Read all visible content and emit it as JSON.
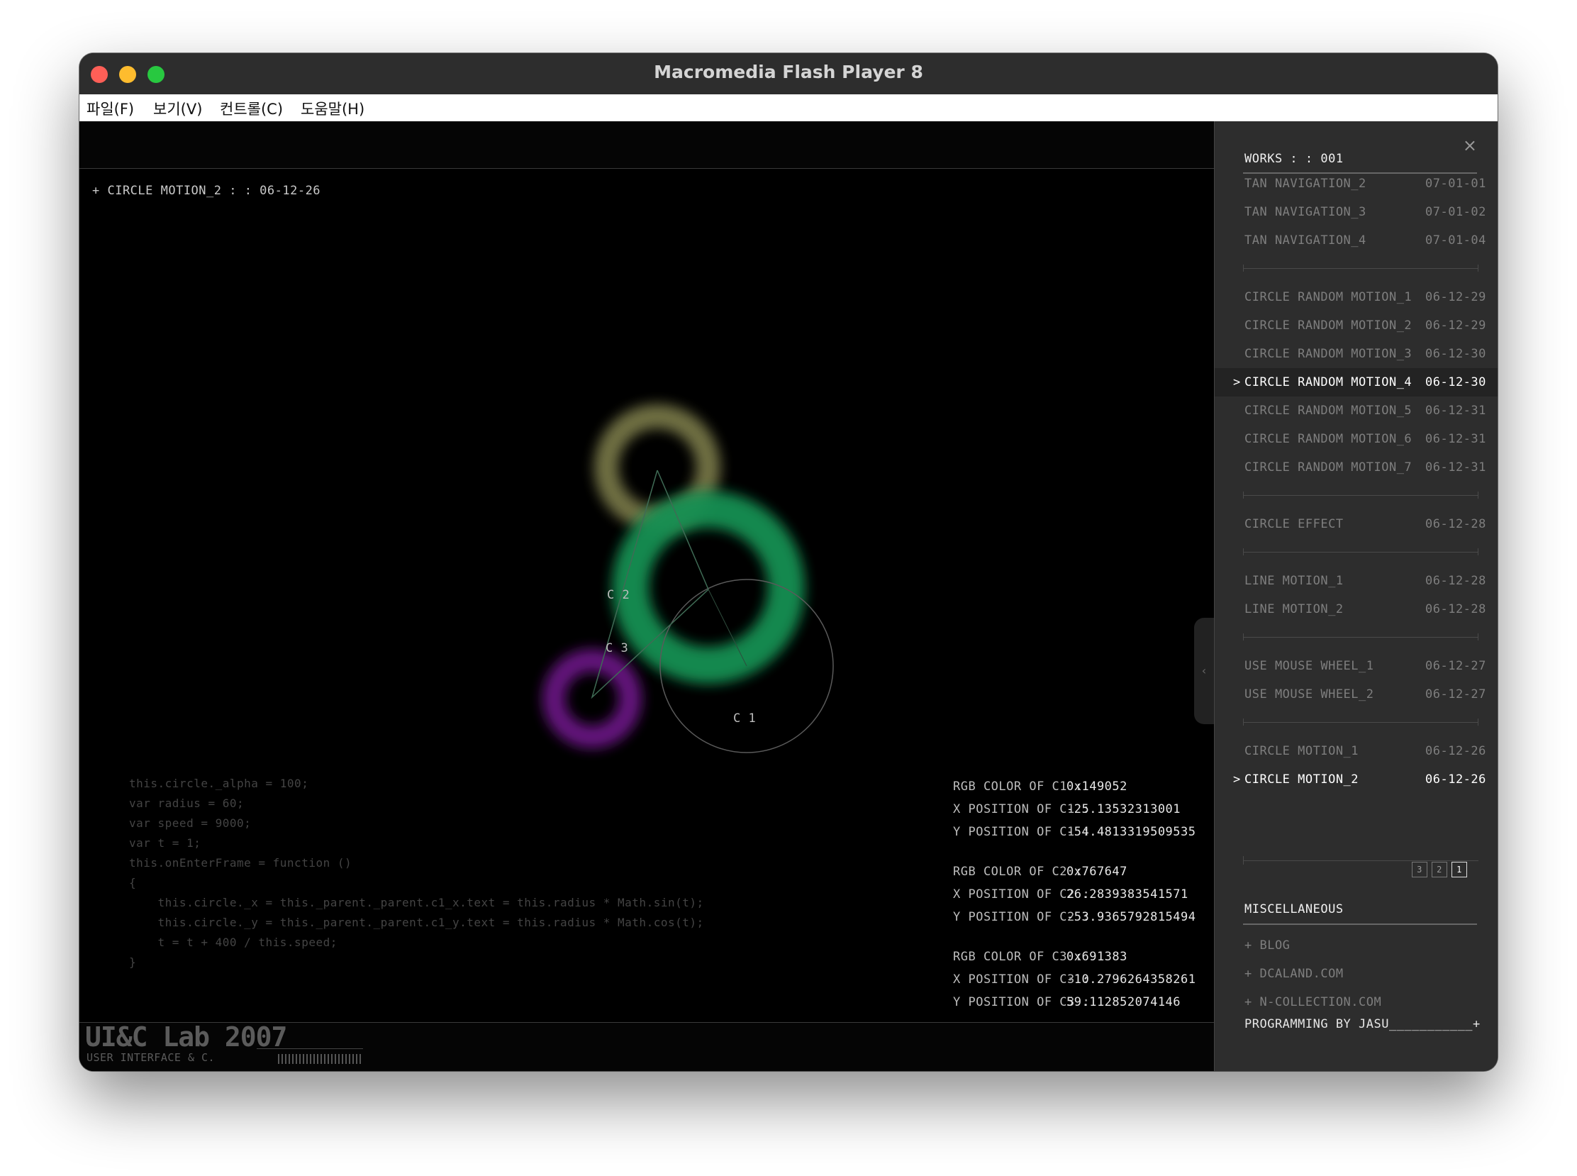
{
  "window": {
    "title": "Macromedia Flash Player 8"
  },
  "menu": {
    "items": [
      "파일(F)",
      "보기(V)",
      "컨트롤(C)",
      "도움말(H)"
    ]
  },
  "stage": {
    "title": "+ CIRCLE MOTION_2 : : 06-12-26",
    "circle_labels": [
      "C 1",
      "C 2",
      "C 3"
    ],
    "code_lines": [
      "this.circle._alpha = 100;",
      "var radius = 60;",
      "var speed = 9000;",
      "var t = 1;",
      "this.onEnterFrame = function ()",
      "{",
      "    this.circle._x = this._parent._parent.c1_x.text = this.radius * Math.sin(t);",
      "    this.circle._y = this._parent._parent.c1_y.text = this.radius * Math.cos(t);",
      "    t = t + 400 / this.speed;",
      "}"
    ],
    "info": [
      {
        "label": "RGB COLOR OF C1 :",
        "value": "0x149052"
      },
      {
        "label": "X POSITION OF C1 :",
        "value": "-25.13532313001"
      },
      {
        "label": "Y POSITION OF C1 :",
        "value": "-54.4813319509535"
      },
      {
        "label": "RGB COLOR OF C2 :",
        "value": "0x767647"
      },
      {
        "label": "X POSITION OF C2 :",
        "value": "26.2839383541571"
      },
      {
        "label": "Y POSITION OF C2 :",
        "value": "-53.9365792815494"
      },
      {
        "label": "RGB COLOR OF C3 :",
        "value": "0x691383"
      },
      {
        "label": "X POSITION OF C3 :",
        "value": "-10.2796264358261"
      },
      {
        "label": "Y POSITION OF C3 :",
        "value": "59.112852074146"
      }
    ],
    "logo": "UI&C Lab 2007",
    "logo_sub": "USER INTERFACE & C.",
    "circle_colors": {
      "c1": "#149052",
      "c2": "#767647",
      "c3": "#691383"
    }
  },
  "panel": {
    "works_title": "WORKS : : 001",
    "groups": [
      [
        {
          "name": "TAN NAVIGATION_2",
          "date": "07-01-01"
        },
        {
          "name": "TAN NAVIGATION_3",
          "date": "07-01-02"
        },
        {
          "name": "TAN NAVIGATION_4",
          "date": "07-01-04"
        }
      ],
      [
        {
          "name": "CIRCLE RANDOM MOTION_1",
          "date": "06-12-29"
        },
        {
          "name": "CIRCLE RANDOM MOTION_2",
          "date": "06-12-29"
        },
        {
          "name": "CIRCLE RANDOM MOTION_3",
          "date": "06-12-30"
        },
        {
          "name": "CIRCLE RANDOM MOTION_4",
          "date": "06-12-30",
          "selected": true
        },
        {
          "name": "CIRCLE RANDOM MOTION_5",
          "date": "06-12-31"
        },
        {
          "name": "CIRCLE RANDOM MOTION_6",
          "date": "06-12-31"
        },
        {
          "name": "CIRCLE RANDOM MOTION_7",
          "date": "06-12-31"
        }
      ],
      [
        {
          "name": "CIRCLE EFFECT",
          "date": "06-12-28"
        }
      ],
      [
        {
          "name": "LINE MOTION_1",
          "date": "06-12-28"
        },
        {
          "name": "LINE MOTION_2",
          "date": "06-12-28"
        }
      ],
      [
        {
          "name": "USE MOUSE WHEEL_1",
          "date": "06-12-27"
        },
        {
          "name": "USE MOUSE WHEEL_2",
          "date": "06-12-27"
        }
      ],
      [
        {
          "name": "CIRCLE MOTION_1",
          "date": "06-12-26"
        },
        {
          "name": "CIRCLE MOTION_2",
          "date": "06-12-26",
          "active": true
        }
      ]
    ],
    "pages": [
      "3",
      "2",
      "1"
    ],
    "current_page": "1",
    "misc_title": "MISCELLANEOUS",
    "misc_items": [
      "+ BLOG",
      "+ DCALAND.COM",
      "+ N-COLLECTION.COM"
    ],
    "credit": "PROGRAMMING BY JASU___________+"
  }
}
